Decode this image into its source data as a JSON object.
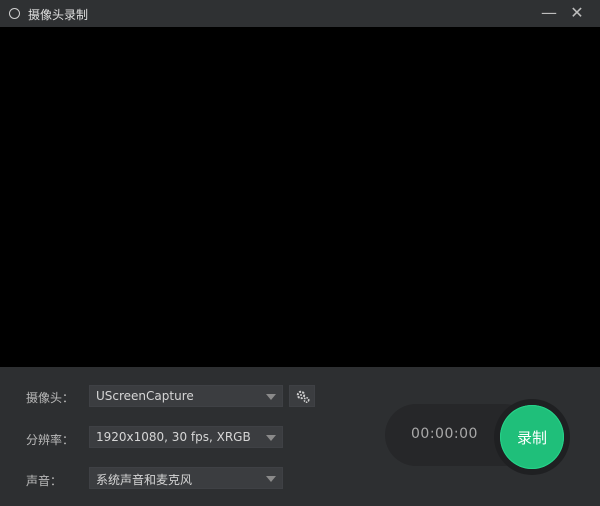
{
  "window": {
    "title": "摄像头录制",
    "minimize_glyph": "—",
    "close_glyph": "✕"
  },
  "settings": {
    "camera": {
      "label": "摄像头：",
      "value": "UScreenCapture"
    },
    "resolution": {
      "label": "分辨率：",
      "value": "1920x1080, 30 fps, XRGB"
    },
    "audio": {
      "label": "声音：",
      "value": "系统声音和麦克风"
    }
  },
  "recorder": {
    "timer": "00:00:00",
    "record_label": "录制",
    "accent_color": "#1fbf7a"
  },
  "icons": {
    "app": "record-circle-icon",
    "settings": "gear-icon",
    "dropdown": "chevron-down-icon"
  }
}
